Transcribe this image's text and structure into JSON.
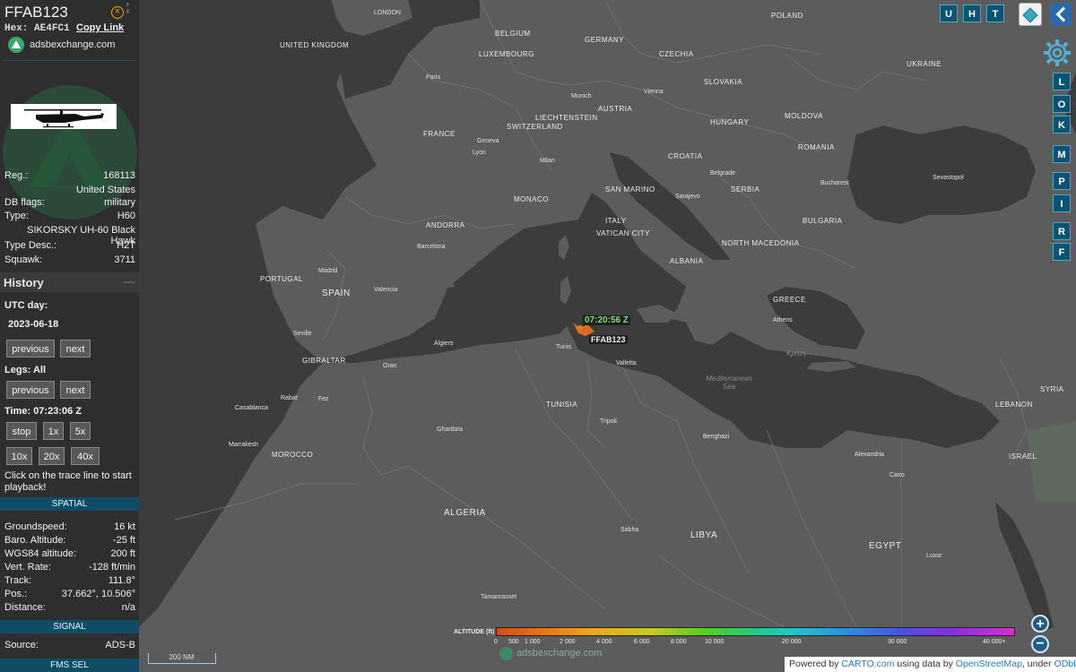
{
  "aircraft": {
    "callsign": "FFAB123",
    "hex_label": "Hex:",
    "hex": "AE4FC1",
    "copy_link": "Copy Link",
    "site": "adsbexchange.com",
    "reg_label": "Reg.:",
    "reg": "168113",
    "country": "United States",
    "dbflags_label": "DB flags:",
    "dbflags": "military",
    "type_label": "Type:",
    "type": "H60",
    "type_name": "SIKORSKY UH-60 Black Hawk",
    "typedesc_label": "Type Desc.:",
    "typedesc": "H2T",
    "squawk_label": "Squawk:",
    "squawk": "3711"
  },
  "history": {
    "title": "History",
    "collapse": "—",
    "utc_day_label": "UTC day:",
    "utc_day": "2023-06-18",
    "previous": "previous",
    "next": "next",
    "legs_label": "Legs: All",
    "time_label": "Time: 07:23:06 Z",
    "speed_buttons": [
      "stop",
      "1x",
      "5x",
      "10x",
      "20x",
      "40x"
    ],
    "hint": "Click on the trace line to start playback!"
  },
  "spatial": {
    "title": "SPATIAL",
    "rows": [
      {
        "label": "Groundspeed:",
        "value": "16 kt"
      },
      {
        "label": "Baro. Altitude:",
        "value": "-25 ft"
      },
      {
        "label": "WGS84 altitude:",
        "value": "200 ft"
      },
      {
        "label": "Vert. Rate:",
        "value": "-128 ft/min"
      },
      {
        "label": "Track:",
        "value": "111.8°"
      },
      {
        "label": "Pos.:",
        "value": "37.662°, 10.506°"
      },
      {
        "label": "Distance:",
        "value": "n/a"
      }
    ]
  },
  "signal": {
    "title": "SIGNAL",
    "source_label": "Source:",
    "source": "ADS-B"
  },
  "fms": {
    "title": "FMS SEL"
  },
  "map": {
    "top_buttons": [
      "U",
      "H",
      "T"
    ],
    "side_buttons": [
      "L",
      "O",
      "K",
      "M",
      "P",
      "I",
      "R",
      "F"
    ],
    "trace_time": "07:20:56 Z",
    "trace_callsign": "FFAB123",
    "scale": "200 NM",
    "watermark": "adsbexchange.com",
    "attribution_pre": "Powered by ",
    "attribution_carto": "CARTO.com",
    "attribution_mid": " using data by ",
    "attribution_osm": "OpenStreetMap",
    "attribution_post": ", under ",
    "attribution_odbl": "ODbL.",
    "zoom_in": "+",
    "zoom_out": "−",
    "altitude_legend": {
      "title": "ALTITUDE (ft)",
      "ticks": [
        "0",
        "500",
        "1 000",
        "2 000",
        "4 000",
        "6 000",
        "8 000",
        "10 000",
        "20 000",
        "30 000",
        "40 000+"
      ]
    },
    "countries": [
      "UNITED KINGDOM",
      "BELGIUM",
      "LUXEMBOURG",
      "GERMANY",
      "POLAND",
      "CZECHIA",
      "SLOVAKIA",
      "UKRAINE",
      "MOLDOVA",
      "FRANCE",
      "SWITZERLAND",
      "LIECHTENSTEIN",
      "AUSTRIA",
      "HUNGARY",
      "ROMANIA",
      "CROATIA",
      "SERBIA",
      "SAN MARINO",
      "ITALY",
      "MONACO",
      "ANDORRA",
      "VATICAN CITY",
      "BULGARIA",
      "NORTH MACEDONIA",
      "ALBANIA",
      "GREECE",
      "PORTUGAL",
      "SPAIN",
      "GIBRALTAR",
      "MOROCCO",
      "ALGERIA",
      "TUNISIA",
      "LIBYA",
      "EGYPT",
      "SYRIA",
      "LEBANON",
      "ISRAEL"
    ],
    "cities": [
      "LONDON",
      "Paris",
      "Munich",
      "Vienna",
      "Geneva",
      "Lyon",
      "Milan",
      "Belgrade",
      "Sarajevo",
      "Bucharest",
      "Sevastopol",
      "Barcelona",
      "Madrid",
      "Valencia",
      "Seville",
      "Algiers",
      "Oran",
      "Tunis",
      "Valletta",
      "Athens",
      "Rabat",
      "Fez",
      "Casablanca",
      "Marrakesh",
      "Ghardaïa",
      "Tripoli",
      "Benghazi",
      "Alexandria",
      "Cairo",
      "Luxor",
      "Sabha",
      "Tamanrasset"
    ],
    "seas": [
      "Mediterranean Sea",
      "Κρήτη"
    ]
  }
}
